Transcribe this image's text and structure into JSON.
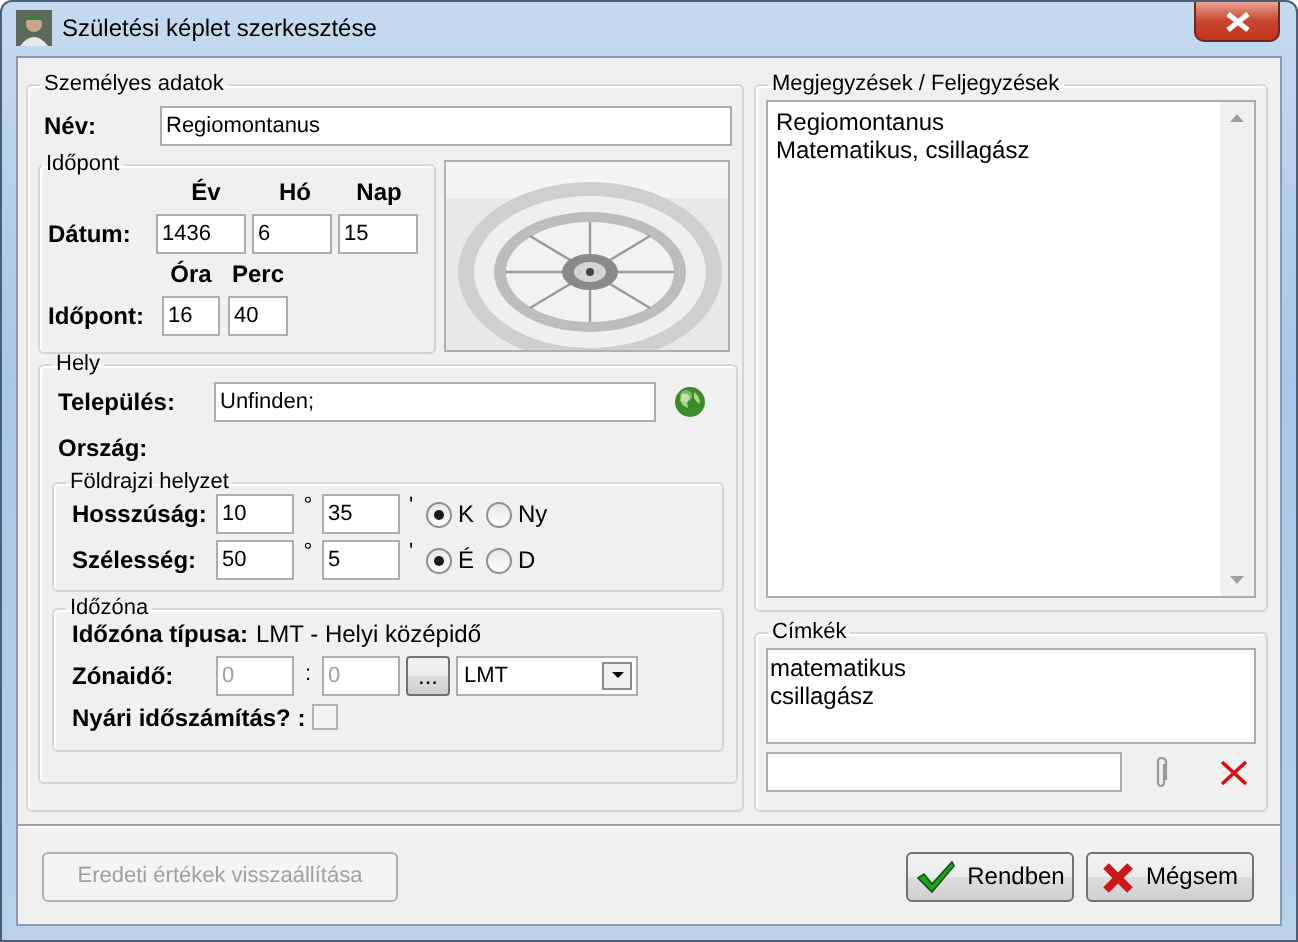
{
  "window": {
    "title": "Születési képlet szerkesztése"
  },
  "personal": {
    "legend": "Személyes adatok",
    "name_label": "Név:",
    "name_value": "Regiomontanus"
  },
  "time": {
    "legend": "Időpont",
    "date_label": "Dátum:",
    "date_fields": [
      {
        "header": "Év",
        "value": "1436"
      },
      {
        "header": "Hó",
        "value": "6"
      },
      {
        "header": "Nap",
        "value": "15"
      }
    ],
    "time_label": "Időpont:",
    "time_fields": [
      {
        "header": "Óra",
        "value": "16"
      },
      {
        "header": "Perc",
        "value": "40"
      }
    ]
  },
  "place": {
    "legend": "Hely",
    "settlement_label": "Település:",
    "settlement_value": "Unfinden;",
    "country_label": "Ország:"
  },
  "geo": {
    "legend": "Földrajzi helyzet",
    "rows": [
      {
        "label": "Hosszúság:",
        "degrees": "10",
        "degree_sign": "°",
        "minutes": "35",
        "minute_sign": "'",
        "options": [
          {
            "label": "K",
            "selected": true
          },
          {
            "label": "Ny",
            "selected": false
          }
        ]
      },
      {
        "label": "Szélesség:",
        "degrees": "50",
        "degree_sign": "°",
        "minutes": "5",
        "minute_sign": "'",
        "options": [
          {
            "label": "É",
            "selected": true
          },
          {
            "label": "D",
            "selected": false
          }
        ]
      }
    ]
  },
  "timezone": {
    "legend": "Időzóna",
    "type_label": "Időzóna típusa:",
    "type_value": "LMT - Helyi középidő",
    "zone_label": "Zónaidő:",
    "zone_hours": "0",
    "separator": ":",
    "zone_minutes": "0",
    "zone_disabled": true,
    "browse_button": "...",
    "zone_select": "LMT",
    "dst_label": "Nyári időszámítás? :",
    "dst_checked": false,
    "dst_disabled": true
  },
  "notes": {
    "legend": "Megjegyzések / Feljegyzések",
    "lines": [
      "Regiomontanus",
      "Matematikus, csillagász"
    ]
  },
  "tags": {
    "legend": "Címkék",
    "items": [
      "matematikus",
      "csillagász"
    ]
  },
  "buttons": [
    {
      "label": "Eredeti értékek visszaállítása",
      "kind": "reset",
      "disabled": true
    },
    {
      "label": "Rendben",
      "kind": "ok",
      "disabled": false
    },
    {
      "label": "Mégsem",
      "kind": "cancel",
      "disabled": false
    }
  ]
}
